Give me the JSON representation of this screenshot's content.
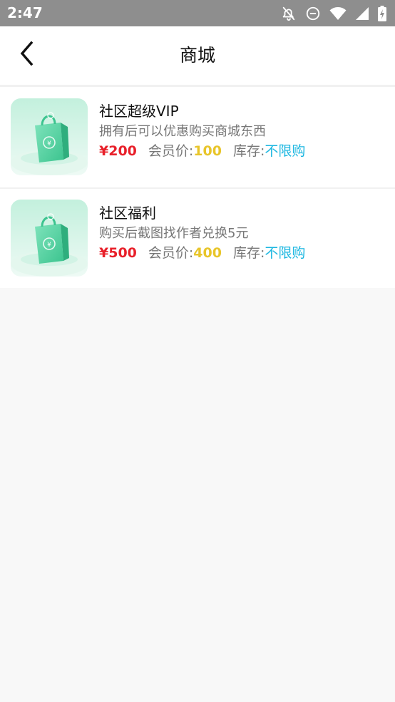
{
  "status_bar": {
    "time": "2:47",
    "icons": [
      "notifications-off-icon",
      "do-not-disturb-icon",
      "wifi-icon",
      "cell-signal-icon",
      "battery-charging-icon"
    ]
  },
  "header": {
    "title": "商城",
    "back_icon": "chevron-left-icon"
  },
  "products": [
    {
      "name": "社区超级VIP",
      "description": "拥有后可以优惠购买商城东西",
      "price": "¥200",
      "member_label": "会员价:",
      "member_price": "100",
      "stock_label": "库存:",
      "stock_value": "不限购",
      "image_icon": "shopping-bag-icon"
    },
    {
      "name": "社区福利",
      "description": "购买后截图找作者兑换5元",
      "price": "¥500",
      "member_label": "会员价:",
      "member_price": "400",
      "stock_label": "库存:",
      "stock_value": "不限购",
      "image_icon": "shopping-bag-icon"
    }
  ],
  "colors": {
    "price": "#e8202a",
    "member_price": "#e8c52a",
    "stock_value": "#1ab6e0",
    "status_bar": "#8e8e8e"
  }
}
